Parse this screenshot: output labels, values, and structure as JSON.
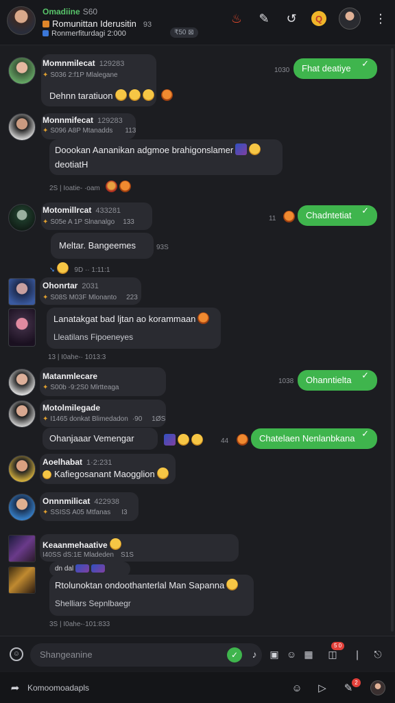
{
  "header": {
    "title": "Omadiine",
    "title_num": "S60",
    "line2": "Romunittan Iderusitin",
    "line2_num": "93",
    "line3": "Ronmerfiturdagi 2:000",
    "chip": "₹50 ⊠"
  },
  "messages": [
    {
      "sender": "Momnmilecat",
      "num": "129283",
      "meta": "S036 2:f1P Mlalegane",
      "text": "Dehnn taratiuon",
      "right": {
        "num": "1030",
        "text": "Fhat deatiye"
      }
    },
    {
      "sender": "Monnmifecat",
      "num": "129283",
      "meta": "S096 A8P Mtanadds",
      "meta_extra": "113",
      "text": "Doookan Aananikan adgmoe brahigonslamer",
      "text2": "deotiatH",
      "time": "2S | Ioatie- ·oam"
    },
    {
      "sender": "Motomillrcat",
      "num": "433281",
      "meta": "S05e A 1P Slnanalgo",
      "meta_extra": "133",
      "text": "Meltar. Bangeemes",
      "text_num": "93S",
      "time": "9D ·· 1:11:1",
      "right": {
        "num": "11",
        "text": "Chadntetiat"
      }
    },
    {
      "sender": "Ohonrtar",
      "num": "2031",
      "meta": "S08S M03F Mlonanto",
      "meta_extra": "223",
      "text": "Lanatakgat bad ljtan ao korammaan",
      "text2": "Lleatilans Fipoeneyes",
      "time": "13 | I0ahe-· 1013:3"
    },
    {
      "sender": "Matanmlecare",
      "meta": "S00b -9:2S0 Mlrtteaga",
      "right": {
        "num": "1038",
        "text": "Ohanntielta"
      }
    },
    {
      "sender": "Motolmilegade",
      "meta": "I1465 donkat Blimedadon",
      "meta_extra": "·90",
      "meta_extra2": "1ØS",
      "text": "Ohanjaaar Vemengar",
      "right": {
        "num": "44",
        "text": "Chatelaen Nenlanbkana"
      }
    },
    {
      "sender": "Aoelhabat",
      "num": "1·2:231",
      "text": "Kafiegosanant Maogglion"
    },
    {
      "sender": "Onnnmilicat",
      "num": "422938",
      "meta": "SSISS A05 Mtfanas",
      "meta_extra": "I3"
    },
    {
      "sender": "Keaanmehaative",
      "meta": "I40SS dS:1E Mladeden",
      "meta_extra": "S1S",
      "meta2": "dn dal",
      "text": "Rtolunoktan ondoothanterlal Man Sapanna",
      "text2": "Shelliars Sepnlbaegr",
      "time": "3S | I0ahe-·101:833"
    }
  ],
  "composer": {
    "left_icon": "☺",
    "placeholder": "Shangeanine",
    "badge": "5 0"
  },
  "bottombar": {
    "label": "Komoomoadapls",
    "badge": "2"
  },
  "icons": {
    "header": [
      "fire-icon",
      "pen-icon",
      "refresh-icon",
      "badge-icon",
      "avatar",
      "more-icon"
    ],
    "composer": [
      "emoji-icon",
      "send-icon",
      "microphone-icon",
      "sticker-icon",
      "emoji-icon",
      "gif-icon",
      "inbox-icon",
      "divider",
      "pin-icon"
    ],
    "bottombar": [
      "share-icon",
      "emoji-icon",
      "reply-icon",
      "edit-icon",
      "avatar"
    ]
  },
  "colors": {
    "accent": "#3fb54d",
    "bg": "#1c1d21",
    "bubble": "#2a2b31"
  }
}
